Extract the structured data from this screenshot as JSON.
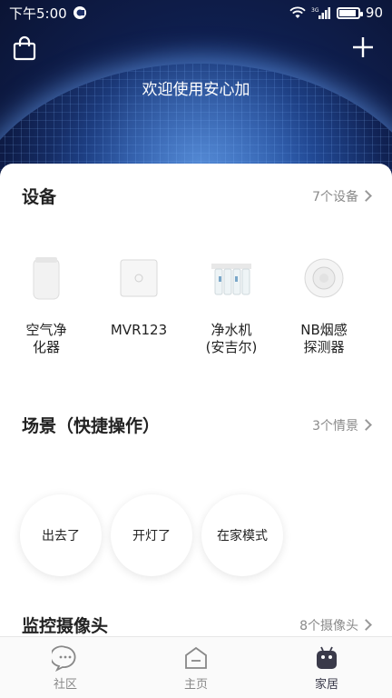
{
  "status_bar": {
    "time": "下午5:00",
    "network": "3G",
    "battery": "90"
  },
  "hero": {
    "title": "欢迎使用安心加"
  },
  "devices": {
    "title": "设备",
    "more": "7个设备",
    "items": [
      {
        "label": "空气净\n化器",
        "icon": "air-purifier"
      },
      {
        "label": "MVR123",
        "icon": "router-box"
      },
      {
        "label": "净水机\n(安吉尔)",
        "icon": "water-purifier"
      },
      {
        "label": "NB烟感\n探测器",
        "icon": "smoke-detector"
      }
    ]
  },
  "scenes": {
    "title": "场景（快捷操作）",
    "more": "3个情景",
    "items": [
      "出去了",
      "开灯了",
      "在家模式"
    ]
  },
  "cameras": {
    "title": "监控摄像头",
    "more": "8个摄像头"
  },
  "bottom_nav": [
    {
      "label": "社区",
      "icon": "chat-bubble-icon"
    },
    {
      "label": "主页",
      "icon": "home-icon"
    },
    {
      "label": "家居",
      "icon": "robot-icon",
      "active": true
    }
  ]
}
